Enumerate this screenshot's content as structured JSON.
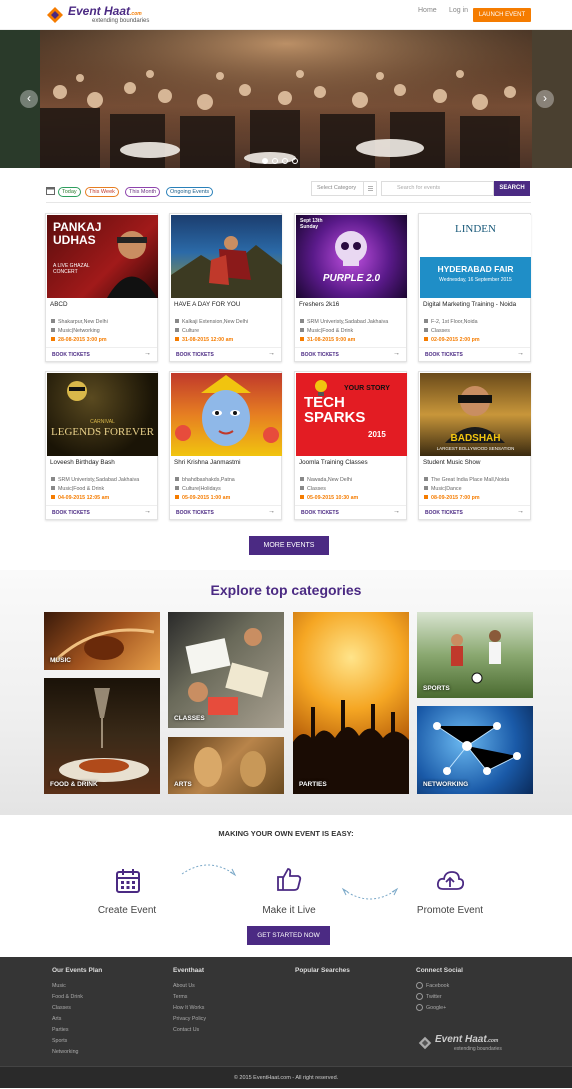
{
  "header": {
    "logo_title": "Event Haat",
    "logo_suffix": ".com",
    "logo_tagline": "extending boundaries",
    "nav": [
      "Home",
      "Log in"
    ],
    "launch": "LAUNCH EVENT"
  },
  "filters": {
    "today": "Today",
    "week": "This Week",
    "month": "This Month",
    "ongoing": "Ongoing Events"
  },
  "search": {
    "category": "Select Category",
    "placeholder": "Search for events",
    "button": "SEARCH"
  },
  "events": [
    {
      "poster_title": "PANKAJ UDHAS",
      "poster_sub": "A LIVE GHAZAL CONCERT",
      "name": "ABCD",
      "location": "Shakarpur,New Delhi",
      "tags": "Music|Networking",
      "date": "28-08-2015 3:00 pm",
      "book": "BOOK TICKETS"
    },
    {
      "poster_title": "",
      "poster_sub": "",
      "name": "HAVE A DAY FOR YOU",
      "location": "Kalkaji Extension,New Delhi",
      "tags": "Culture",
      "date": "31-08-2015 12:00 am",
      "book": "BOOK TICKETS"
    },
    {
      "poster_title": "PURPLE 2.0",
      "poster_sub": "Sept 13th Sunday",
      "name": "Freshers 2k16",
      "location": "SRM Univeristy,Sadabad Jakhaiva",
      "tags": "Music|Food & Drink",
      "date": "31-08-2015 9:00 am",
      "book": "BOOK TICKETS"
    },
    {
      "poster_title": "HYDERABAD FAIR",
      "poster_sub": "Wednesday, 16 September 2015",
      "poster_brand": "LINDEN",
      "name": "Digital Marketing Training - Noida",
      "location": "F-2, 1st Floor,Noida",
      "tags": "Classes",
      "date": "02-09-2015 2:00 pm",
      "book": "BOOK TICKETS"
    },
    {
      "poster_title": "LEGENDS FOREVER",
      "poster_sub": "CARNIVAL",
      "name": "Loveesh Birthday Bash",
      "location": "SRM Univeristy,Sadabad Jakhaiva",
      "tags": "Music|Food & Drink",
      "date": "04-09-2015 12:05 am",
      "book": "BOOK TICKETS"
    },
    {
      "poster_title": "",
      "poster_sub": "",
      "name": "Shri Krishna Janmastmi",
      "location": "bhahdbashakds,Patna",
      "tags": "Culture|Holidays",
      "date": "05-09-2015 1:00 am",
      "book": "BOOK TICKETS"
    },
    {
      "poster_title": "TECH SPARKS",
      "poster_sub": "YOUR STORY",
      "poster_year": "2015",
      "name": "Joomla Training Classes",
      "location": "Nawada,New Delhi",
      "tags": "Classes",
      "date": "05-09-2015 10:30 am",
      "book": "BOOK TICKETS"
    },
    {
      "poster_title": "BADSHAH",
      "poster_sub": "LARGEST BOLLYWOOD SENSATION",
      "name": "Student Music Show",
      "location": "The Great India Place Mall,Noida",
      "tags": "Music|Dance",
      "date": "08-09-2015 7:00 pm",
      "book": "BOOK TICKETS"
    }
  ],
  "more_events": "MORE EVENTS",
  "categories": {
    "title": "Explore top categories",
    "items": [
      "MUSIC",
      "CLASSES",
      "PARTIES",
      "SPORTS",
      "FOOD & DRINK",
      "ARTS",
      "NETWORKING"
    ]
  },
  "steps": {
    "heading": "MAKING YOUR OWN EVENT IS EASY:",
    "items": [
      "Create Event",
      "Make it Live",
      "Promote Event"
    ],
    "cta": "GET STARTED NOW"
  },
  "footer": {
    "col1": {
      "title": "Our Events Plan",
      "links": [
        "Music",
        "Food & Drink",
        "Classes",
        "Arts",
        "Parties",
        "Sports",
        "Networking"
      ]
    },
    "col2": {
      "title": "Eventhaat",
      "links": [
        "About Us",
        "Terms",
        "How It Works",
        "Privacy Policy",
        "Contact Us"
      ]
    },
    "col3": {
      "title": "Popular Searches"
    },
    "col4": {
      "title": "Connect Social",
      "links": [
        "Facebook",
        "Twitter",
        "Google+"
      ]
    },
    "copyright": "© 2015 EventHaat.com - All right reserved."
  },
  "colors": {
    "brand": "#4b2a83",
    "accent": "#f57c00"
  }
}
